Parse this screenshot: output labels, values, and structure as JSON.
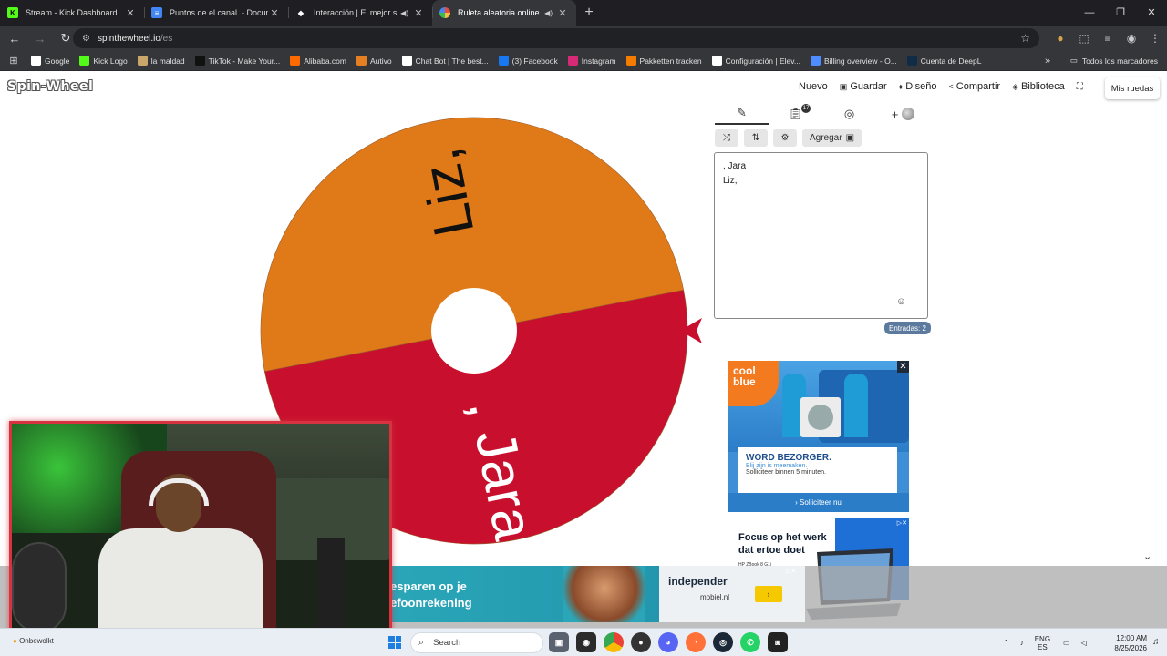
{
  "browser": {
    "tabs": [
      {
        "title": "Stream - Kick Dashboard",
        "icon": "kick-icon",
        "color": "#53fc18",
        "active": false,
        "audio": false
      },
      {
        "title": "Puntos de el canal. - Document",
        "icon": "docs-icon",
        "color": "#4285f4",
        "active": false,
        "audio": false
      },
      {
        "title": "Interacción | El mejor softw",
        "icon": "app-icon",
        "color": "#ffffff",
        "active": false,
        "audio": true
      },
      {
        "title": "Ruleta aleatoria online – rul",
        "icon": "wheel-icon",
        "color": "#e94b3c",
        "active": true,
        "audio": true
      }
    ],
    "new_tab": "+",
    "url_host": "spinthewheel.io",
    "url_path": "/es",
    "bookmarks": [
      {
        "label": "Google",
        "color": "#ffffff"
      },
      {
        "label": "Kick Logo",
        "color": "#53fc18"
      },
      {
        "label": "la maldad",
        "color": "#caa66a"
      },
      {
        "label": "TikTok - Make Your...",
        "color": "#111111"
      },
      {
        "label": "Alibaba.com",
        "color": "#ff6a00"
      },
      {
        "label": "Autivo",
        "color": "#e67e22"
      },
      {
        "label": "Chat Bot | The best...",
        "color": "#ffffff"
      },
      {
        "label": "(3) Facebook",
        "color": "#1877f2"
      },
      {
        "label": "Instagram",
        "color": "#d62976"
      },
      {
        "label": "Pakketten tracken",
        "color": "#f57c00"
      },
      {
        "label": "Configuración | Elev...",
        "color": "#ffffff"
      },
      {
        "label": "Billing overview - O...",
        "color": "#4e8cff"
      },
      {
        "label": "Cuenta de DeepL",
        "color": "#0f2b46"
      }
    ],
    "bookmarks_more": "»",
    "all_bookmarks": "Todos los marcadores"
  },
  "site": {
    "logo": "Spin-Wheel",
    "menu": [
      {
        "label": "Nuevo",
        "icon": ""
      },
      {
        "label": "Guardar",
        "icon": "save-icon"
      },
      {
        "label": "Diseño",
        "icon": "paint-icon"
      },
      {
        "label": "Compartir",
        "icon": "share-icon"
      },
      {
        "label": "Biblioteca",
        "icon": "library-icon"
      }
    ],
    "mis_ruedas": "Mis ruedas"
  },
  "wheel": {
    "segments": [
      {
        "label": "Liz,",
        "color": "#e07a18"
      },
      {
        "label": ", Jara",
        "color": "#c8102e"
      }
    ],
    "pointer_color": "#c8102e"
  },
  "editor": {
    "tabs": [
      "edit-icon",
      "clipboard-icon",
      "hide-icon",
      "add-icon"
    ],
    "clipboard_badge": "17",
    "add_label": "+",
    "buttons": {
      "shuffle": "⤮",
      "sort": "⇅",
      "settings": "⚙",
      "add_image": "Agregar"
    },
    "entries_text": [
      ", Jara",
      "Liz,"
    ],
    "entries_count": "Entradas: 2"
  },
  "ads": {
    "coolblue": {
      "brand_line1": "cool",
      "brand_line2": "blue",
      "headline": "WORD BEZORGER.",
      "sub1": "Blij zijn is meemaken.",
      "sub2": "Solliciteer binnen 5 minuten.",
      "cta": "› Solliciteer nu"
    },
    "hp": {
      "headline": "Focus op het werk dat ertoe doet",
      "small": "HP ZBook 8 G1i"
    },
    "bottom": {
      "line1": "esparen op je",
      "line2": "efoonrekening",
      "brand": "independer",
      "sub": "mobiel.nl",
      "button": "›"
    }
  },
  "taskbar": {
    "weather": "Onbewolkt",
    "search": "Search",
    "lang_top": "ENG",
    "lang_bottom": "ES",
    "time": "12:00 AM",
    "date": "8/25/2026"
  }
}
